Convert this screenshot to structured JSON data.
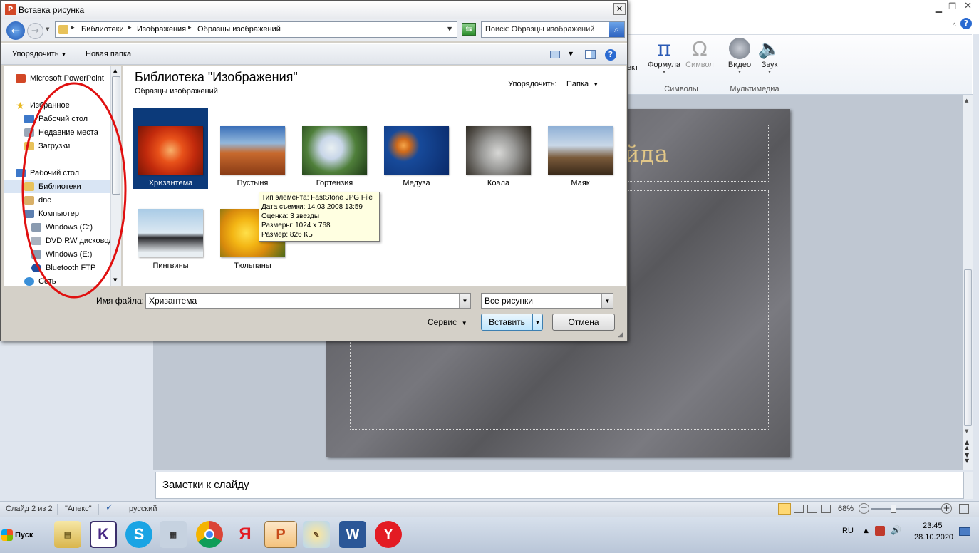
{
  "dialog": {
    "title": "Вставка рисунка",
    "breadcrumb": [
      "Библиотеки",
      "Изображения",
      "Образцы изображений"
    ],
    "search_placeholder": "Поиск: Образцы изображений",
    "toolbar": {
      "organize": "Упорядочить",
      "new_folder": "Новая папка"
    },
    "nav": {
      "items": [
        {
          "label": "Microsoft PowerPoint",
          "icon": "powerpoint-icon"
        },
        {
          "label": "Избранное",
          "icon": "star-icon"
        },
        {
          "label": "Рабочий стол",
          "icon": "desktop-icon"
        },
        {
          "label": "Недавние места",
          "icon": "recent-places-icon"
        },
        {
          "label": "Загрузки",
          "icon": "downloads-icon"
        },
        {
          "label": "Рабочий стол",
          "icon": "desktop-icon"
        },
        {
          "label": "Библиотеки",
          "icon": "libraries-icon"
        },
        {
          "label": "dnc",
          "icon": "user-folder-icon"
        },
        {
          "label": "Компьютер",
          "icon": "computer-icon"
        },
        {
          "label": "Windows (C:)",
          "icon": "drive-icon"
        },
        {
          "label": "DVD RW дисковод",
          "icon": "dvd-drive-icon"
        },
        {
          "label": "Windows (E:)",
          "icon": "drive-icon"
        },
        {
          "label": "Bluetooth FTP",
          "icon": "bluetooth-icon"
        },
        {
          "label": "Сеть",
          "icon": "network-icon"
        }
      ]
    },
    "library": {
      "title": "Библиотека \"Изображения\"",
      "subtitle": "Образцы изображений",
      "arrange_label": "Упорядочить:",
      "arrange_value": "Папка"
    },
    "thumbnails": [
      "Хризантема",
      "Пустыня",
      "Гортензия",
      "Медуза",
      "Коала",
      "Маяк",
      "Пингвины",
      "Тюльпаны"
    ],
    "tooltip": [
      "Тип элемента: FastStone JPG File",
      "Дата съемки: 14.03.2008 13:59",
      "Оценка: 3 звезды",
      "Размеры: 1024 x 768",
      "Размер: 826 КБ"
    ],
    "filename_label": "Имя файла:",
    "filename_value": "Хризантема",
    "filetype_value": "Все рисунки",
    "service": "Сервис",
    "insert": "Вставить",
    "cancel": "Отмена"
  },
  "ribbon": {
    "partial_label": "ект",
    "formula": "Формула",
    "symbol": "Символ",
    "video": "Видео",
    "sound": "Звук",
    "group_symbols": "Символы",
    "group_media": "Мультимедиа"
  },
  "slide": {
    "title_fragment": "йда"
  },
  "notes": {
    "placeholder": "Заметки к слайду"
  },
  "statusbar": {
    "slide": "Слайд 2 из 2",
    "theme": "\"Апекс\"",
    "language": "русский",
    "zoom": "68%"
  },
  "taskbar": {
    "start": "Пуск",
    "lang": "RU",
    "time": "23:45",
    "date": "28.10.2020"
  }
}
